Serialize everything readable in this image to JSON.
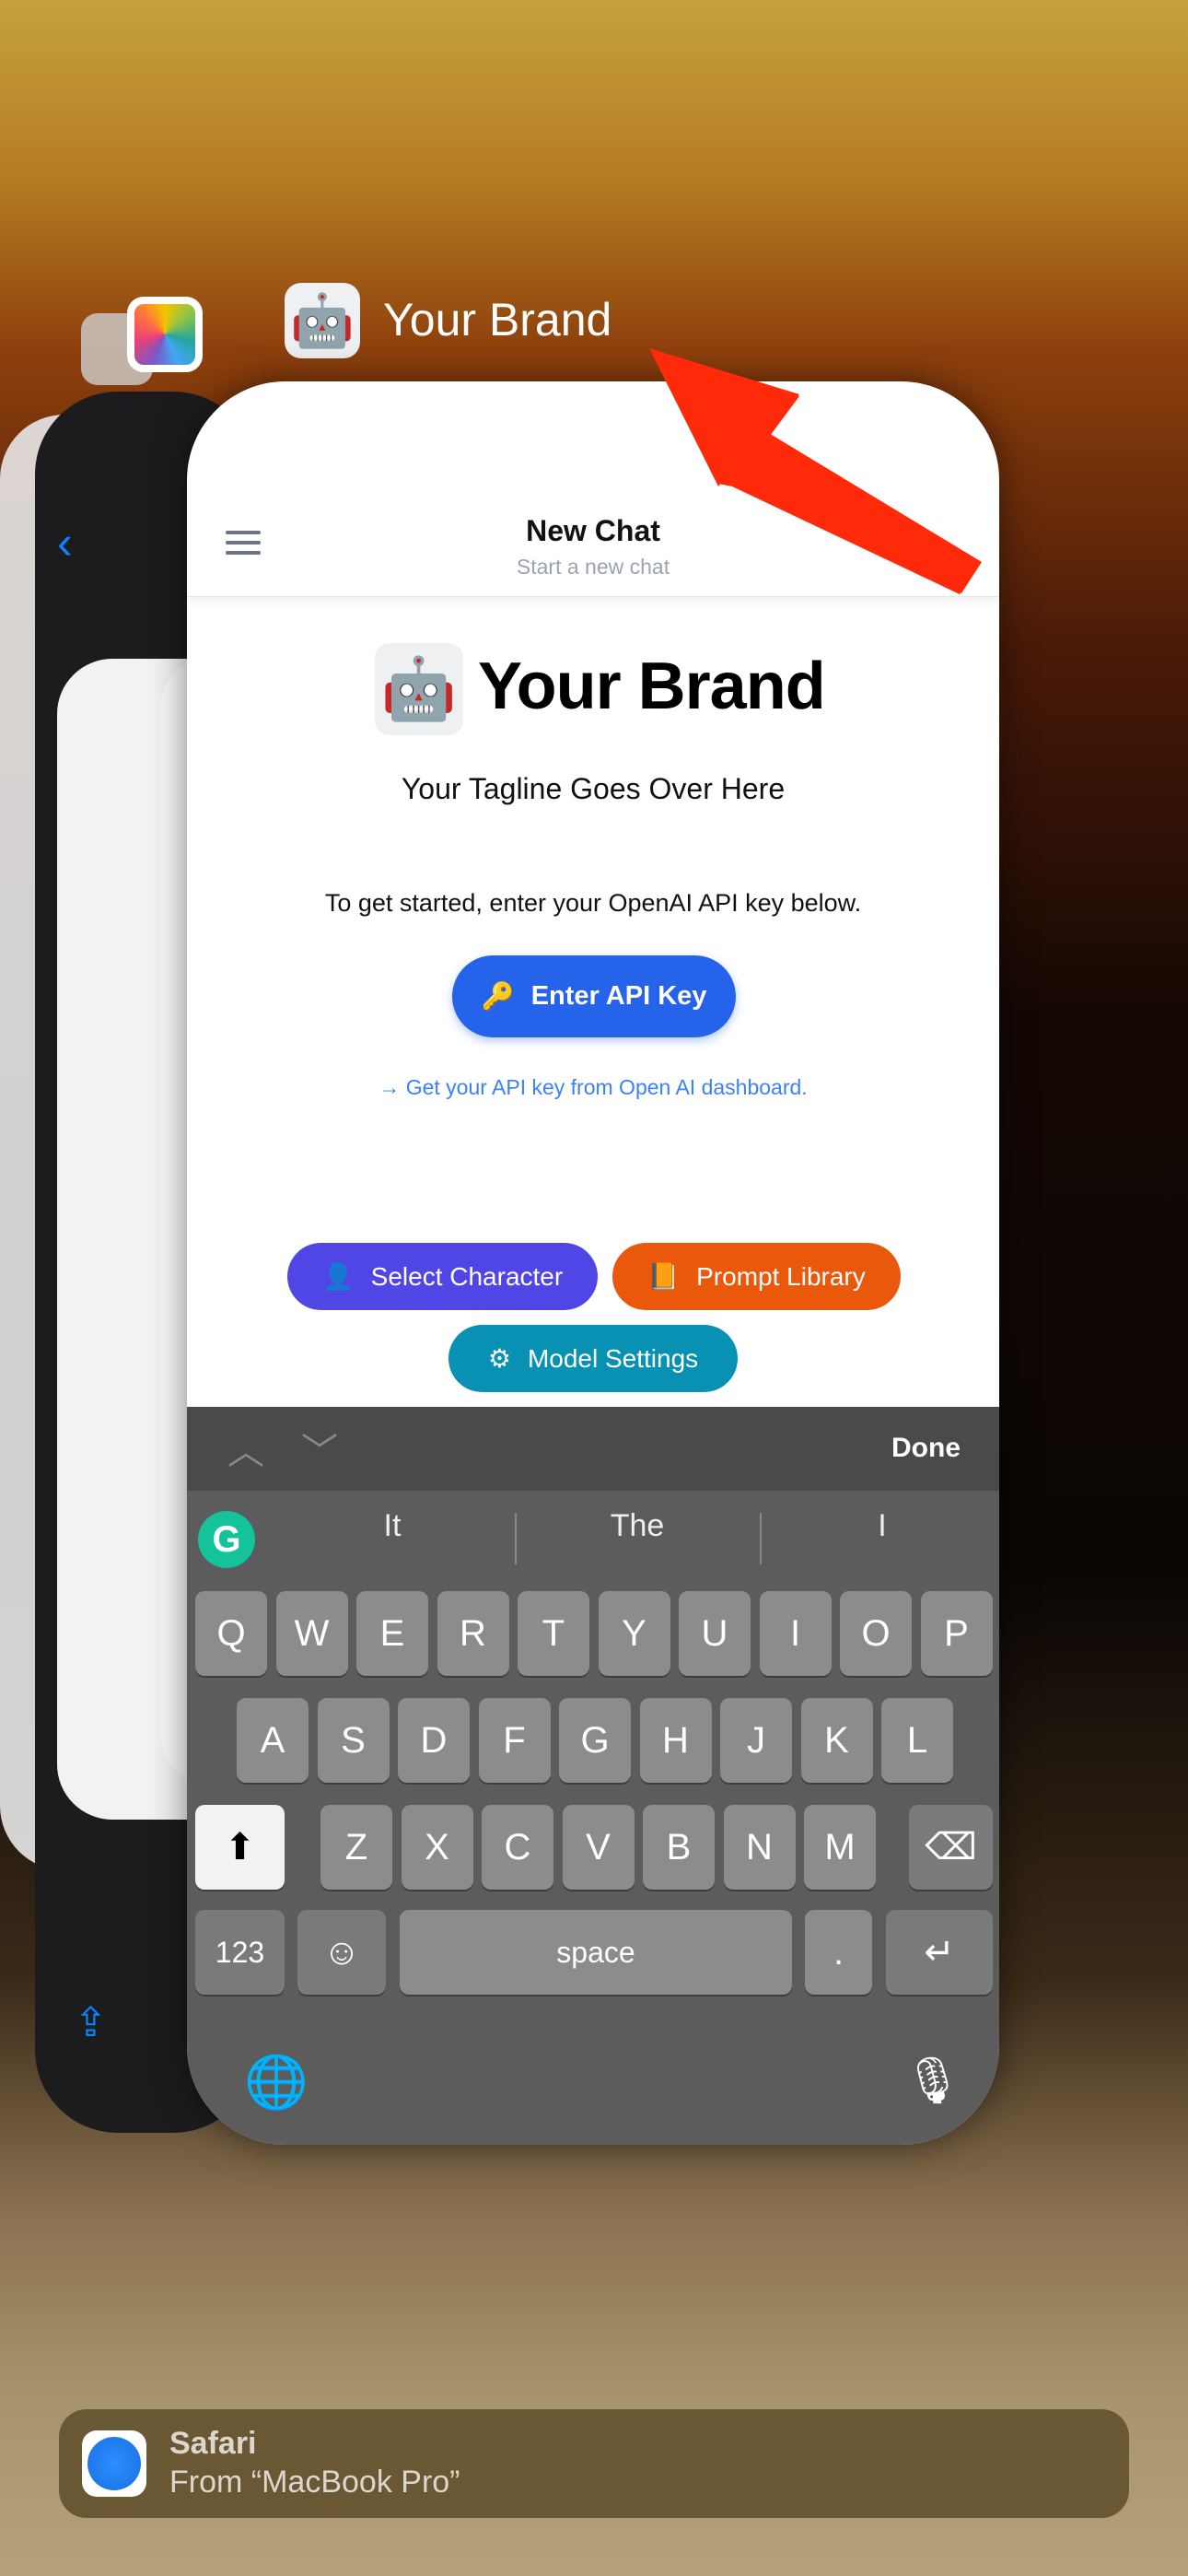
{
  "switcher": {
    "app_title": "Your Brand"
  },
  "chat": {
    "title": "New Chat",
    "subtitle": "Start a new chat",
    "brand_name": "Your Brand",
    "tagline": "Your Tagline Goes Over Here",
    "instructions": "To get started, enter your OpenAI API key below.",
    "enter_key_label": "Enter API Key",
    "api_link": "→ Get your API key from Open AI dashboard.",
    "select_character": "Select Character",
    "prompt_library": "Prompt Library",
    "model_settings": "Model Settings"
  },
  "colors": {
    "primary": "#2563eb",
    "character": "#4f46e5",
    "library": "#ea580c",
    "settings": "#0891b2",
    "arrow": "#ff2a0a"
  },
  "keyboard": {
    "done": "Done",
    "suggestions": [
      "It",
      "The",
      "I"
    ],
    "rows": [
      [
        "Q",
        "W",
        "E",
        "R",
        "T",
        "Y",
        "U",
        "I",
        "O",
        "P"
      ],
      [
        "A",
        "S",
        "D",
        "F",
        "G",
        "H",
        "J",
        "K",
        "L"
      ],
      [
        "Z",
        "X",
        "C",
        "V",
        "B",
        "N",
        "M"
      ]
    ],
    "numbers": "123",
    "space": "space",
    "period": "."
  },
  "handoff": {
    "app": "Safari",
    "source": "From “MacBook Pro”"
  }
}
